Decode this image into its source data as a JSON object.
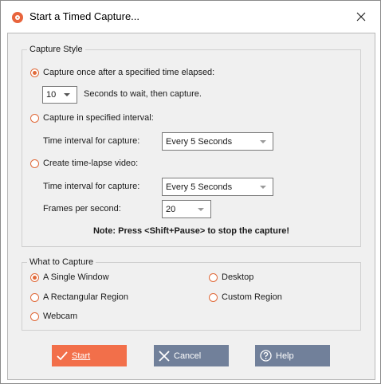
{
  "window": {
    "title": "Start a Timed Capture..."
  },
  "capture_style": {
    "legend": "Capture Style",
    "once": {
      "label": "Capture once after a specified time elapsed:",
      "checked": true,
      "seconds_value": "10",
      "seconds_label": "Seconds to wait, then capture."
    },
    "interval": {
      "label": "Capture in specified interval:",
      "checked": false,
      "time_label": "Time interval for capture:",
      "time_value": "Every 5 Seconds"
    },
    "timelapse": {
      "label": "Create time-lapse video:",
      "checked": false,
      "time_label": "Time interval for capture:",
      "time_value": "Every 5 Seconds",
      "fps_label": "Frames per second:",
      "fps_value": "20"
    },
    "note": "Note: Press <Shift+Pause> to stop the capture!"
  },
  "what_to_capture": {
    "legend": "What to Capture",
    "options": [
      {
        "label": "A Single Window",
        "checked": true
      },
      {
        "label": "Desktop",
        "checked": false
      },
      {
        "label": "A Rectangular Region",
        "checked": false
      },
      {
        "label": "Custom Region",
        "checked": false
      },
      {
        "label": "Webcam",
        "checked": false
      }
    ]
  },
  "buttons": {
    "start": "Start",
    "cancel": "Cancel",
    "help": "Help"
  },
  "colors": {
    "accent": "#f26f4a",
    "secondary_button": "#71809a"
  }
}
